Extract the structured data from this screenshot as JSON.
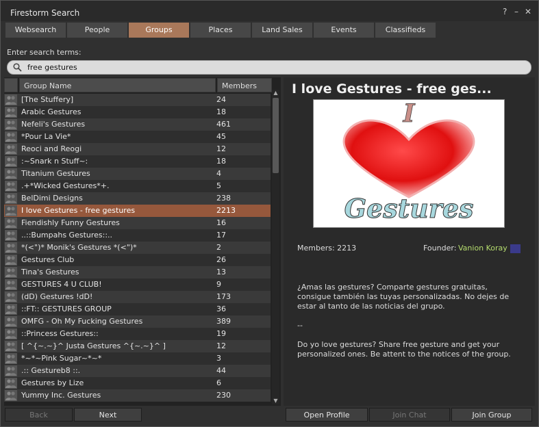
{
  "window": {
    "title": "Firestorm Search",
    "help": "?",
    "minimize": "–",
    "close": "✕"
  },
  "tabs": [
    "Websearch",
    "People",
    "Groups",
    "Places",
    "Land Sales",
    "Events",
    "Classifieds"
  ],
  "active_tab": "Groups",
  "search": {
    "label": "Enter search terms:",
    "value": "free gestures"
  },
  "results": {
    "columns": {
      "name": "Group Name",
      "members": "Members"
    },
    "rows": [
      {
        "name": "[The Stuffery]",
        "members": "24"
      },
      {
        "name": "Arabic Gestures",
        "members": "18"
      },
      {
        "name": "Nefeli's Gestures",
        "members": "461"
      },
      {
        "name": "*Pour La Vie*",
        "members": "45"
      },
      {
        "name": "Reoci and Reogi",
        "members": "12"
      },
      {
        "name": ":~Snark n Stuff~:",
        "members": "18"
      },
      {
        "name": "Titanium Gestures",
        "members": "4"
      },
      {
        "name": ".+*Wicked Gestures*+.",
        "members": "5"
      },
      {
        "name": "BelDimi Designs",
        "members": "238"
      },
      {
        "name": "I love Gestures - free gestures",
        "members": "2213"
      },
      {
        "name": "Fiendishly Funny Gestures",
        "members": "16"
      },
      {
        "name": "..::Bumpahs Gestures::..",
        "members": "17"
      },
      {
        "name": " *(<\")* Monik's Gestures *(<\")*",
        "members": "2"
      },
      {
        "name": "Gestures Club",
        "members": "26"
      },
      {
        "name": "Tina's Gestures",
        "members": "13"
      },
      {
        "name": "GESTURES 4 U CLUB!",
        "members": "9"
      },
      {
        "name": "(dD) Gestures !dD!",
        "members": "173"
      },
      {
        "name": "::FT:: GESTURES GROUP",
        "members": "36"
      },
      {
        "name": "OMFG - Oh My Fucking Gestures",
        "members": "389"
      },
      {
        "name": "::Princess Gestures::",
        "members": "19"
      },
      {
        "name": "[ ^{~.~}^ Justa Gestures ^{~.~}^ ]",
        "members": "12"
      },
      {
        "name": "*~*~Pink Sugar~*~*",
        "members": "3"
      },
      {
        "name": " .:: Gestureb8 ::.",
        "members": "44"
      },
      {
        "name": "Gestures by Lize",
        "members": "6"
      },
      {
        "name": "Yummy Inc. Gestures",
        "members": "230"
      }
    ],
    "selected_index": 9
  },
  "nav": {
    "back": "Back",
    "next": "Next"
  },
  "details": {
    "title": "I love Gestures - free ges...",
    "image_text": {
      "top": "I",
      "bottom": "Gestures"
    },
    "members_label": "Members: 2213",
    "founder_label": "Founder:",
    "founder_name": "Vanion Koray",
    "description": [
      "¿Amas las gestures? Comparte gestures gratuitas, consigue también las tuyas personalizadas. No dejes de estar al tanto de las noticias del grupo.",
      "--",
      "Do yo love gestures? Share free gesture and get your personalized ones.  Be attent to the notices of the group."
    ]
  },
  "actions": {
    "open_profile": "Open Profile",
    "join_chat": "Join Chat",
    "join_group": "Join Group"
  },
  "colors": {
    "accent": "#a9785a",
    "selected_row": "#96583c",
    "founder_link": "#b6de6e"
  }
}
